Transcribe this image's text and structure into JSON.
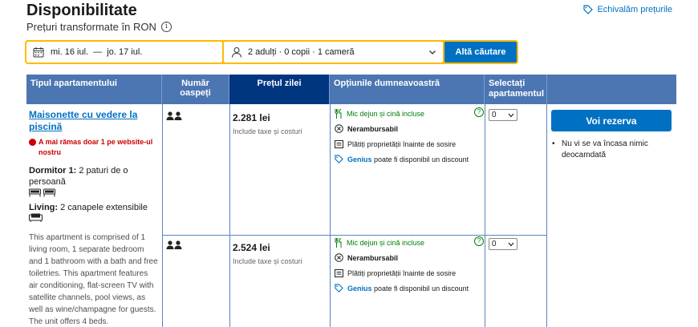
{
  "header": {
    "title": "Disponibilitate",
    "subtitle": "Prețuri transformate în RON",
    "info_icon": "i",
    "price_match": "Echivalăm prețurile"
  },
  "search": {
    "dates": "mi. 16 iul.  —  jo. 17 iul.",
    "guests": "2 adulți · 0 copii · 1 cameră",
    "button": "Altă căutare"
  },
  "table": {
    "headers": [
      "Tipul apartamentului",
      "Număr oaspeți",
      "Prețul zilei",
      "Opțiunile dumneavoastră",
      "Selectați apartamentul"
    ],
    "room": {
      "name": "Maisonette cu vedere la piscină",
      "scarcity": "A mai rămas doar 1 pe website-ul nostru",
      "bedroom_label": "Dormitor 1:",
      "bedroom_value": "2 paturi de o persoană",
      "living_label": "Living:",
      "living_value": "2 canapele extensibile",
      "description": "This apartment is comprised of 1 living room, 1 separate bedroom and 1 bathroom with a bath and free toiletries. This apartment features air conditioning, flat-screen TV with satellite channels, pool views, as well as wine/champagne for guests. The unit offers 4 beds."
    },
    "rows": [
      {
        "price": "2.281 lei",
        "price_note": "Include taxe și costuri",
        "meals": "Mic dejun și cină incluse",
        "refund": "Nerambursabil",
        "payment": "Plătiți proprietății înainte de sosire",
        "genius_label": "Genius",
        "genius_text": "poate fi disponibil un discount",
        "qty": "0",
        "help": "?"
      },
      {
        "price": "2.524 lei",
        "price_note": "Include taxe și costuri",
        "meals": "Mic dejun și cină incluse",
        "refund": "Nerambursabil",
        "payment": "Plătiți proprietății înainte de sosire",
        "genius_label": "Genius",
        "genius_text": "poate fi disponibil un discount",
        "qty": "0",
        "help": "?"
      }
    ],
    "reserve_button": "Voi rezerva",
    "reserve_note": "Nu vi se va încasa nimic deocamdată"
  },
  "colors": {
    "accent": "#0071c2",
    "header": "#4c76b2",
    "header_dark": "#003580",
    "searchbar": "#febb02",
    "meal_green": "#008009",
    "alert_red": "#cc0000"
  }
}
